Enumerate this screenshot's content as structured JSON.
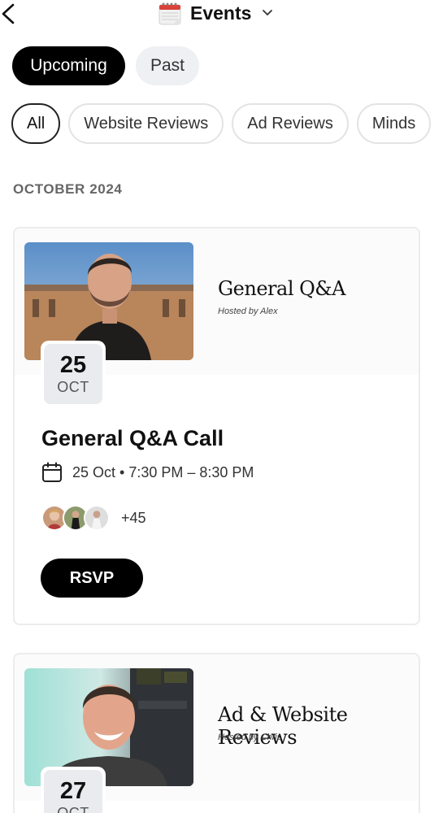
{
  "header": {
    "title": "Events",
    "back_icon": "chevron-left-icon",
    "title_icon": "calendar-emoji-icon",
    "dropdown_icon": "chevron-down-icon"
  },
  "segments": [
    {
      "label": "Upcoming",
      "active": true
    },
    {
      "label": "Past",
      "active": false
    }
  ],
  "filters": [
    {
      "label": "All",
      "selected": true
    },
    {
      "label": "Website Reviews",
      "selected": false
    },
    {
      "label": "Ad Reviews",
      "selected": false
    },
    {
      "label": "Minds",
      "selected": false
    }
  ],
  "month_heading": "OCTOBER 2024",
  "events": [
    {
      "banner_title": "General Q&A",
      "banner_host": "Hosted by Alex",
      "day": "25",
      "month": "OCT",
      "title": "General Q&A Call",
      "time": "25 Oct • 7:30 PM – 8:30 PM",
      "attendee_extra": "+45",
      "rsvp_label": "RSVP"
    },
    {
      "banner_title": "Ad & Website Reviews",
      "banner_host": "Hosted by Chris",
      "day": "27",
      "month": "OCT"
    }
  ],
  "colors": {
    "primary": "#000000",
    "pill_inactive": "#eef0f3",
    "date_box": "#e9ebee"
  }
}
